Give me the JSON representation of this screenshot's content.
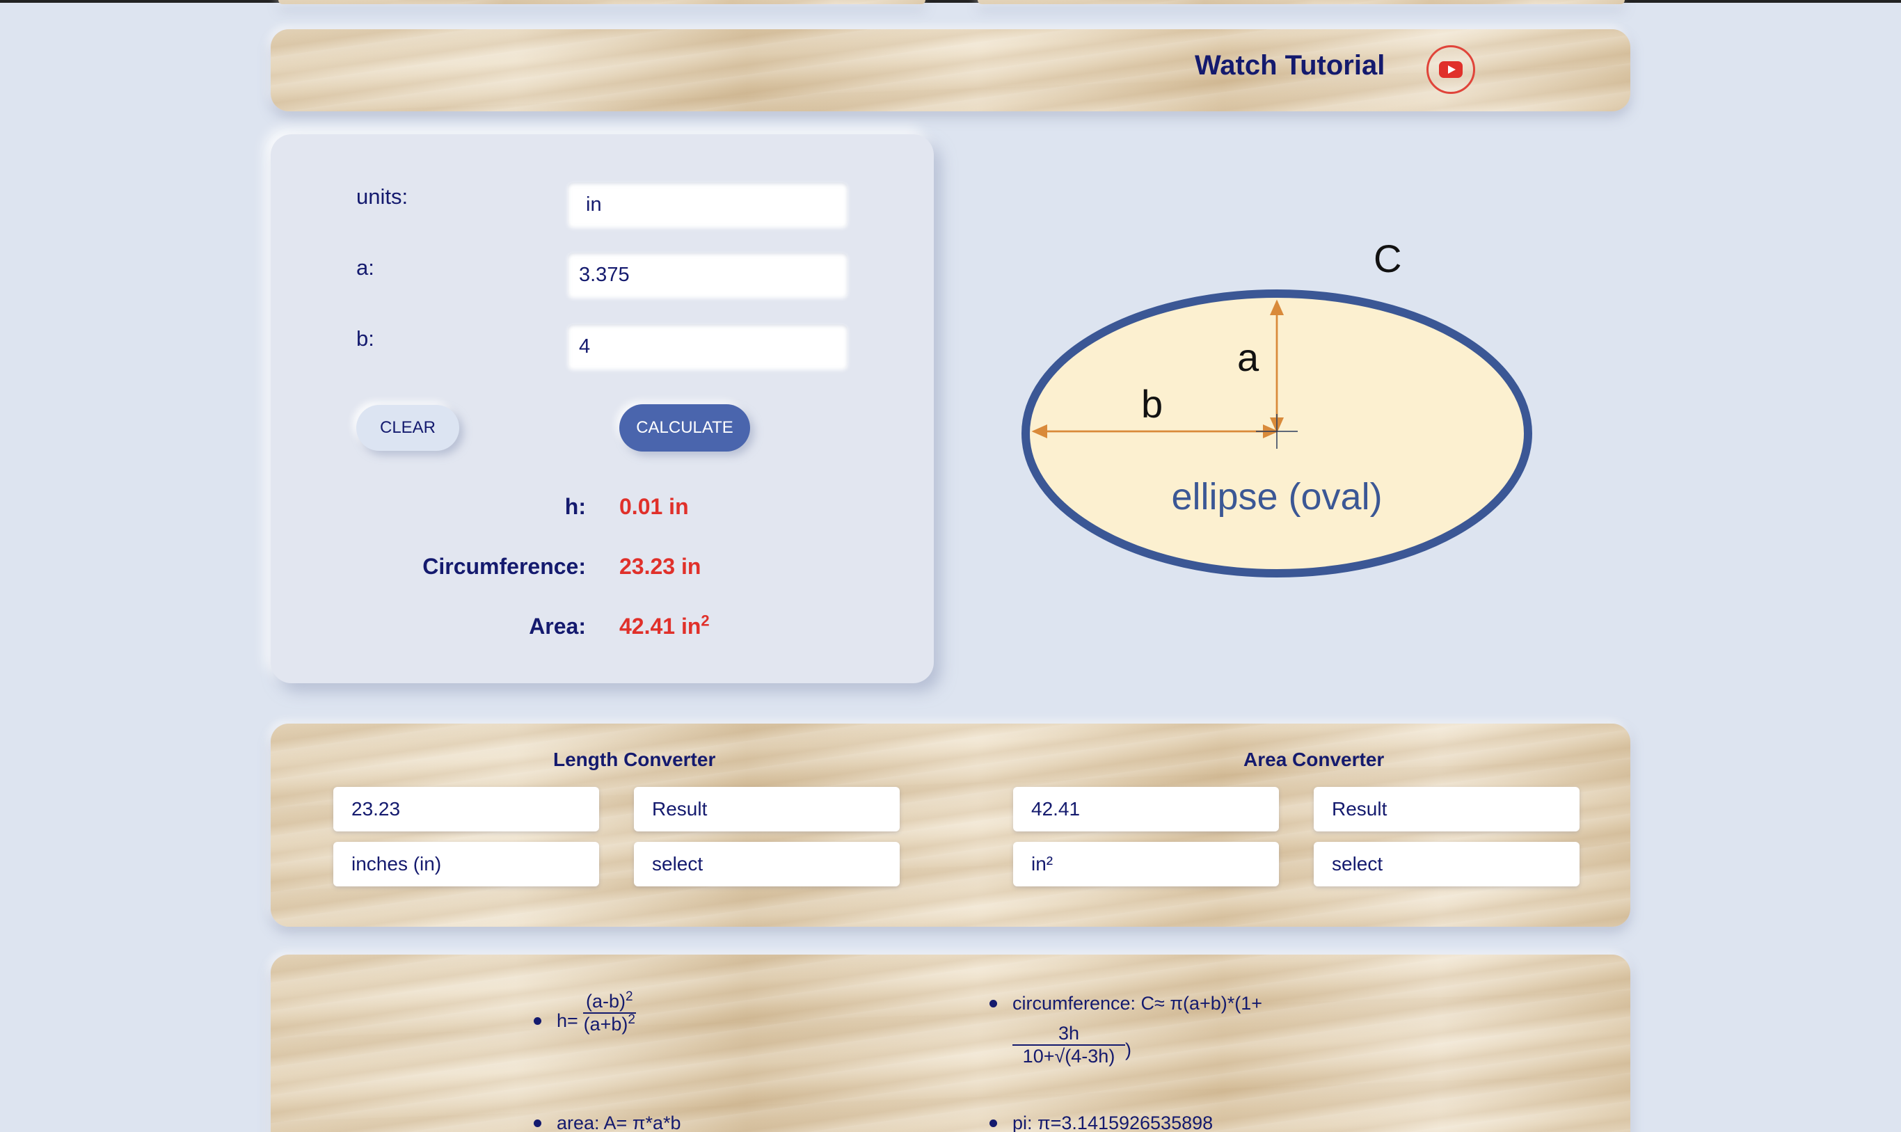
{
  "header": {
    "tutorial_label": "Watch Tutorial",
    "tutorial_icon": "youtube-icon"
  },
  "calculator": {
    "units_label": "units:",
    "units_value": "in",
    "a_label": "a:",
    "a_value": "3.375",
    "b_label": "b:",
    "b_value": "4",
    "clear_label": "CLEAR",
    "calculate_label": "CALCULATE",
    "results": {
      "h_label": "h:",
      "h_value": "0.01 in",
      "circ_label": "Circumference:",
      "circ_value": "23.23 in",
      "area_label": "Area:",
      "area_value": "42.41 in",
      "area_exp": "2"
    }
  },
  "diagram": {
    "label_c": "C",
    "label_a": "a",
    "label_b": "b",
    "caption": "ellipse (oval)",
    "colors": {
      "outline": "#3b5795",
      "fill": "#fcf0d0",
      "arrow": "#d98a3a"
    }
  },
  "converters": {
    "length": {
      "title": "Length Converter",
      "input_value": "23.23",
      "result": "Result",
      "from_unit": "inches (in)",
      "to_unit": "select"
    },
    "area": {
      "title": "Area Converter",
      "input_value": "42.41",
      "result": "Result",
      "from_unit": "in²",
      "to_unit": "select"
    }
  },
  "formulas": {
    "h_prefix": "h=",
    "h_num": "(a-b)",
    "h_den": "(a+b)",
    "exp": "2",
    "circ_text": "circumference: C≈ π(a+b)*(1+",
    "circ_num": "3h",
    "circ_den": "10+√(4-3h)",
    "circ_close": ")",
    "area_text": "area: A= π*a*b",
    "pi_text": "pi: π=3.1415926535898"
  },
  "colors": {
    "background": "#dde4f0",
    "text_primary": "#141a6e",
    "result_red": "#e0302a",
    "button_blue": "#4a65ad"
  }
}
